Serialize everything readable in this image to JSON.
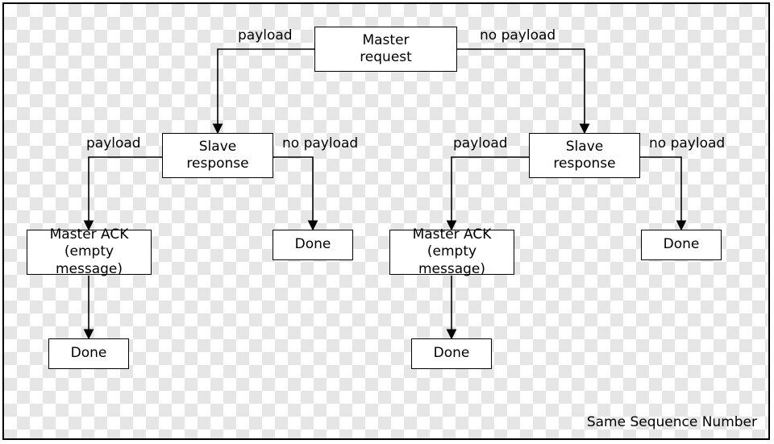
{
  "nodes": {
    "master_request": "Master\nrequest",
    "slave_response_left": "Slave\nresponse",
    "slave_response_right": "Slave\nresponse",
    "master_ack_left": "Master ACK\n(empty message)",
    "master_ack_right": "Master ACK\n(empty message)",
    "done_tl": "Done",
    "done_tr": "Done",
    "done_bl": "Done",
    "done_br": "Done"
  },
  "labels": {
    "e_top_left": "payload",
    "e_top_right": "no payload",
    "e_mid_l_left": "payload",
    "e_mid_l_right": "no payload",
    "e_mid_r_left": "payload",
    "e_mid_r_right": "no payload"
  },
  "footer": "Same Sequence Number"
}
